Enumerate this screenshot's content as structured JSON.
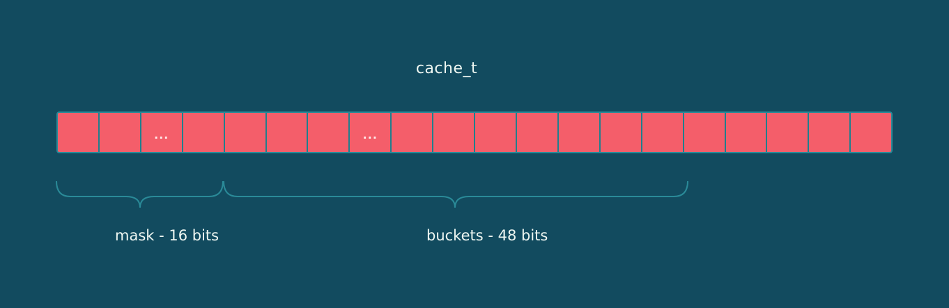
{
  "diagram": {
    "title": "cache_t",
    "cells": [
      "",
      "",
      "...",
      "",
      "",
      "",
      "",
      "...",
      "",
      "",
      "",
      "",
      "",
      "",
      "",
      "",
      "",
      "",
      "",
      ""
    ],
    "mask_label": "mask - 16 bits",
    "buckets_label": "buckets - 48 bits",
    "colors": {
      "background": "#124b5f",
      "cell_fill": "#f45e6a",
      "cell_stroke": "#1f7f8d",
      "text": "#eef7f2"
    }
  }
}
